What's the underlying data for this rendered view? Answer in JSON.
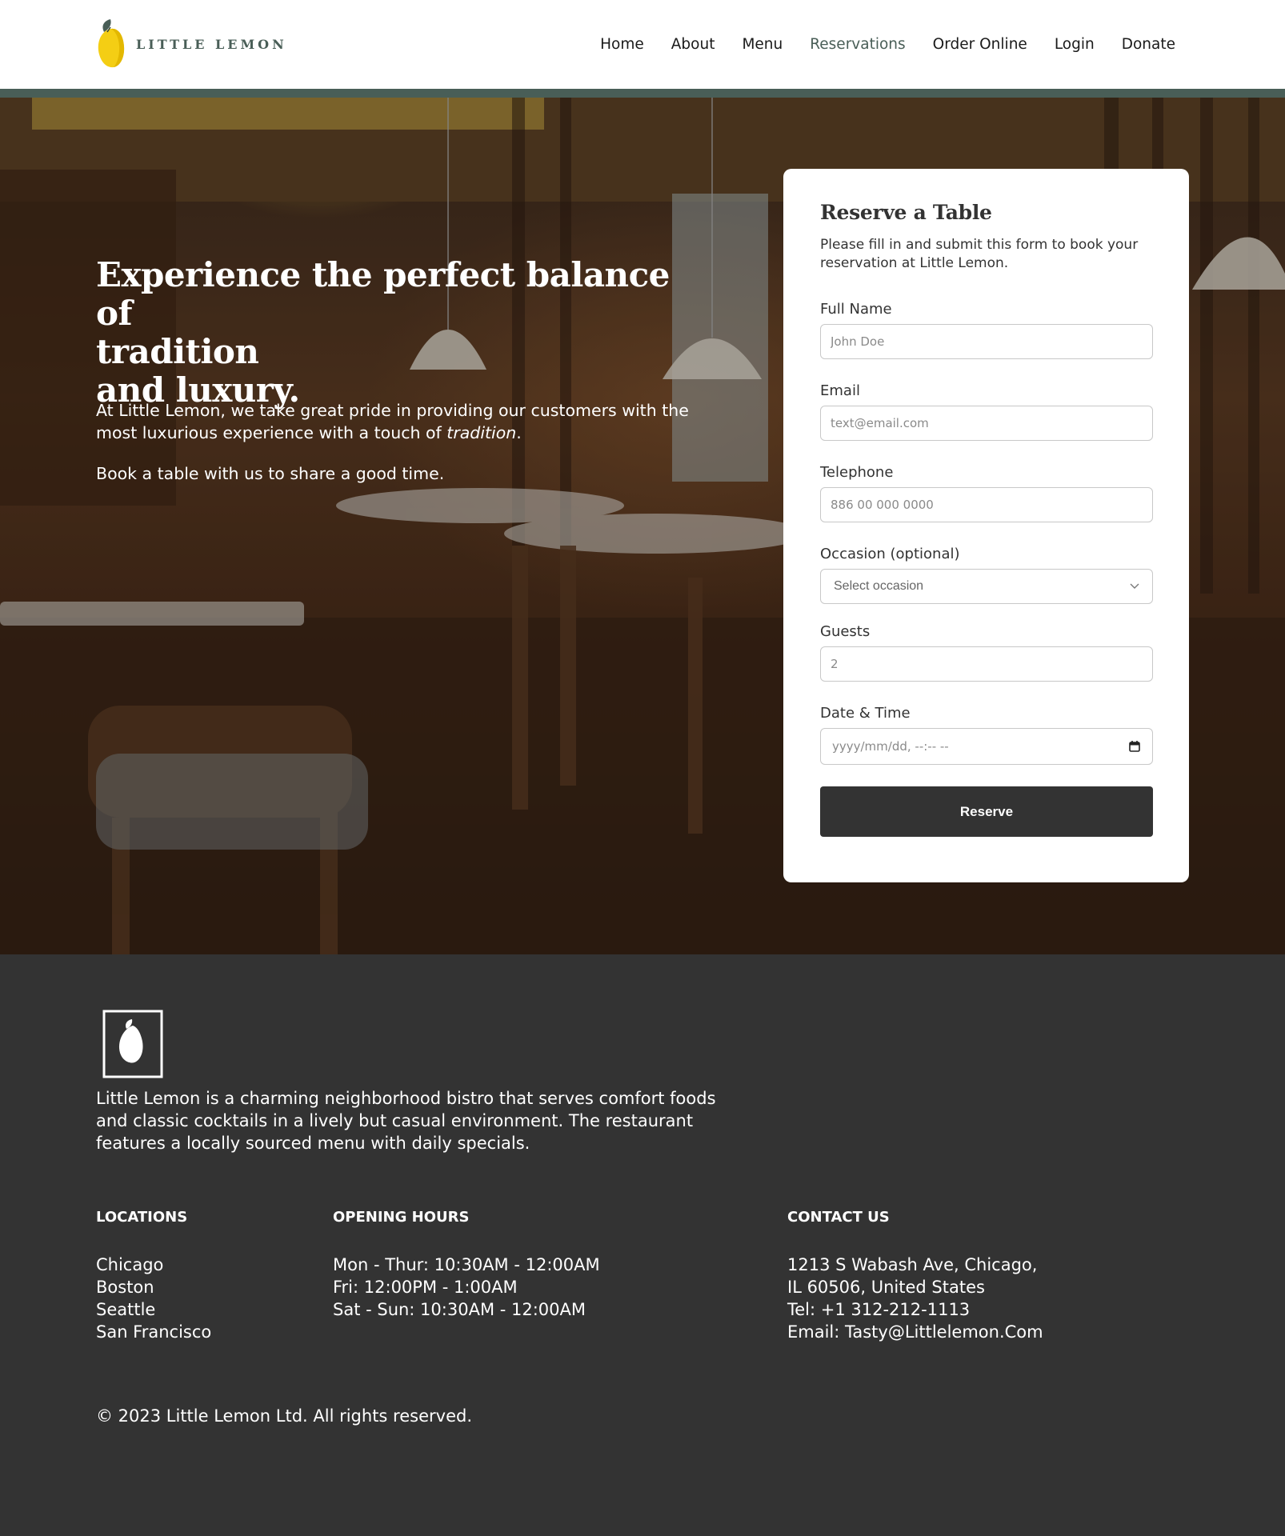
{
  "brand": {
    "name": "LITTLE LEMON",
    "primary_color": "#495e57",
    "accent_color": "#f4ce14",
    "dark_color": "#333333"
  },
  "nav": {
    "items": [
      {
        "label": "Home"
      },
      {
        "label": "About"
      },
      {
        "label": "Menu"
      },
      {
        "label": "Reservations",
        "active": true
      },
      {
        "label": "Order Online"
      },
      {
        "label": "Login"
      },
      {
        "label": "Donate"
      }
    ]
  },
  "hero": {
    "title_lines": [
      "Experience the perfect balance of",
      "tradition",
      "and luxury."
    ],
    "body_prefix": "At Little Lemon, we take great pride in providing our customers with the most luxurious experience with a touch of ",
    "body_emphasis": "tradition",
    "body_suffix": ".",
    "body2": "Book a table with us to share a good time."
  },
  "form": {
    "title": "Reserve a Table",
    "intro": "Please fill in and submit this form to book your reservation at Little Lemon.",
    "full_name": {
      "label": "Full Name",
      "placeholder": "John Doe",
      "value": ""
    },
    "email": {
      "label": "Email",
      "placeholder": "text@email.com",
      "value": ""
    },
    "telephone": {
      "label": "Telephone",
      "placeholder": "886 00 000 0000",
      "value": ""
    },
    "occasion": {
      "label": "Occasion (optional)",
      "selected": "Select occasion"
    },
    "guests": {
      "label": "Guests",
      "placeholder": "2",
      "value": ""
    },
    "datetime": {
      "label": "Date & Time",
      "placeholder": "yyyy/mm/dd, --:-- --"
    },
    "submit_label": "Reserve"
  },
  "footer": {
    "about": "Little Lemon is a charming neighborhood bistro that serves comfort foods and classic cocktails in a lively but casual environment. The restaurant features a locally sourced menu with daily specials.",
    "locations": {
      "heading": "LOCATIONS",
      "items": [
        "Chicago",
        "Boston",
        "Seattle",
        "San Francisco"
      ]
    },
    "hours": {
      "heading": "OPENING HOURS",
      "items": [
        "Mon - Thur: 10:30AM - 12:00AM",
        "Fri: 12:00PM - 1:00AM",
        "Sat - Sun: 10:30AM - 12:00AM"
      ]
    },
    "contact": {
      "heading": "CONTACT US",
      "items": [
        "1213 S Wabash Ave, Chicago,",
        "IL 60506, United States",
        "Tel: +1 312-212-1113",
        "Email: Tasty@Littlelemon.Com"
      ]
    },
    "copyright": "© 2023 Little Lemon Ltd. All rights reserved."
  }
}
